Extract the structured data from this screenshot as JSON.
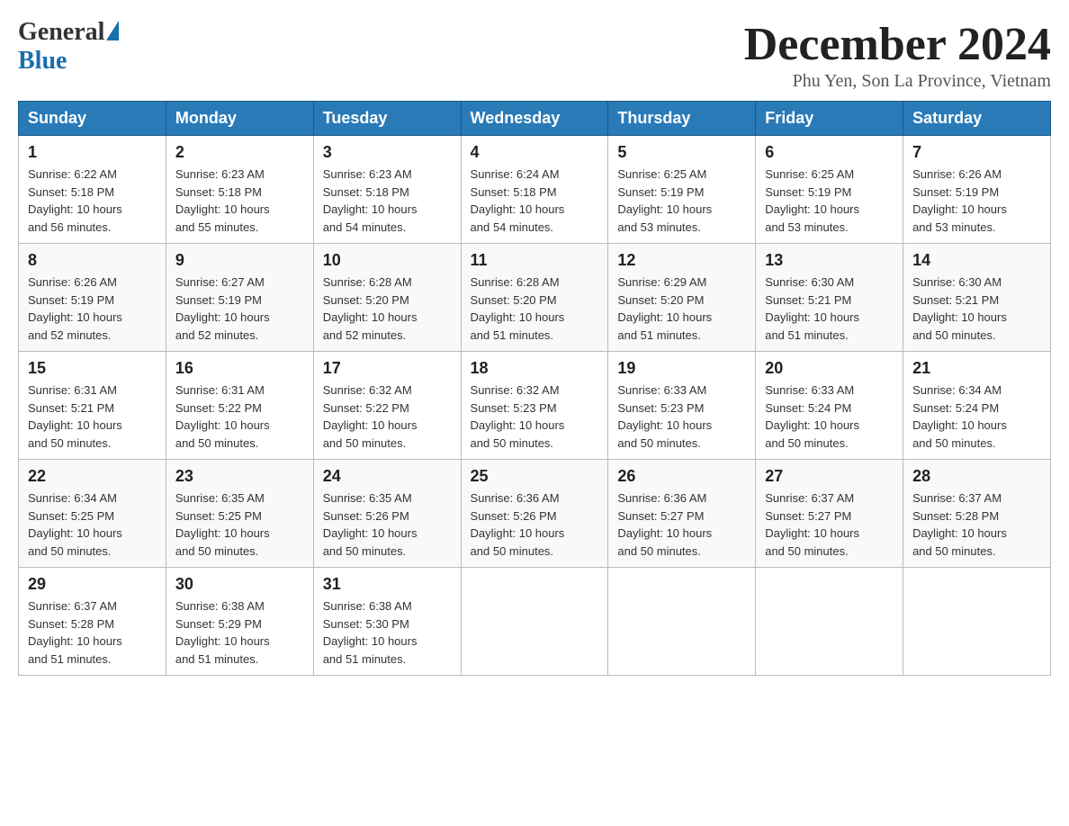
{
  "header": {
    "title": "December 2024",
    "location": "Phu Yen, Son La Province, Vietnam",
    "logo": {
      "general": "General",
      "blue": "Blue"
    }
  },
  "days_of_week": [
    "Sunday",
    "Monday",
    "Tuesday",
    "Wednesday",
    "Thursday",
    "Friday",
    "Saturday"
  ],
  "weeks": [
    [
      {
        "day": "1",
        "sunrise": "6:22 AM",
        "sunset": "5:18 PM",
        "daylight": "10 hours and 56 minutes."
      },
      {
        "day": "2",
        "sunrise": "6:23 AM",
        "sunset": "5:18 PM",
        "daylight": "10 hours and 55 minutes."
      },
      {
        "day": "3",
        "sunrise": "6:23 AM",
        "sunset": "5:18 PM",
        "daylight": "10 hours and 54 minutes."
      },
      {
        "day": "4",
        "sunrise": "6:24 AM",
        "sunset": "5:18 PM",
        "daylight": "10 hours and 54 minutes."
      },
      {
        "day": "5",
        "sunrise": "6:25 AM",
        "sunset": "5:19 PM",
        "daylight": "10 hours and 53 minutes."
      },
      {
        "day": "6",
        "sunrise": "6:25 AM",
        "sunset": "5:19 PM",
        "daylight": "10 hours and 53 minutes."
      },
      {
        "day": "7",
        "sunrise": "6:26 AM",
        "sunset": "5:19 PM",
        "daylight": "10 hours and 53 minutes."
      }
    ],
    [
      {
        "day": "8",
        "sunrise": "6:26 AM",
        "sunset": "5:19 PM",
        "daylight": "10 hours and 52 minutes."
      },
      {
        "day": "9",
        "sunrise": "6:27 AM",
        "sunset": "5:19 PM",
        "daylight": "10 hours and 52 minutes."
      },
      {
        "day": "10",
        "sunrise": "6:28 AM",
        "sunset": "5:20 PM",
        "daylight": "10 hours and 52 minutes."
      },
      {
        "day": "11",
        "sunrise": "6:28 AM",
        "sunset": "5:20 PM",
        "daylight": "10 hours and 51 minutes."
      },
      {
        "day": "12",
        "sunrise": "6:29 AM",
        "sunset": "5:20 PM",
        "daylight": "10 hours and 51 minutes."
      },
      {
        "day": "13",
        "sunrise": "6:30 AM",
        "sunset": "5:21 PM",
        "daylight": "10 hours and 51 minutes."
      },
      {
        "day": "14",
        "sunrise": "6:30 AM",
        "sunset": "5:21 PM",
        "daylight": "10 hours and 50 minutes."
      }
    ],
    [
      {
        "day": "15",
        "sunrise": "6:31 AM",
        "sunset": "5:21 PM",
        "daylight": "10 hours and 50 minutes."
      },
      {
        "day": "16",
        "sunrise": "6:31 AM",
        "sunset": "5:22 PM",
        "daylight": "10 hours and 50 minutes."
      },
      {
        "day": "17",
        "sunrise": "6:32 AM",
        "sunset": "5:22 PM",
        "daylight": "10 hours and 50 minutes."
      },
      {
        "day": "18",
        "sunrise": "6:32 AM",
        "sunset": "5:23 PM",
        "daylight": "10 hours and 50 minutes."
      },
      {
        "day": "19",
        "sunrise": "6:33 AM",
        "sunset": "5:23 PM",
        "daylight": "10 hours and 50 minutes."
      },
      {
        "day": "20",
        "sunrise": "6:33 AM",
        "sunset": "5:24 PM",
        "daylight": "10 hours and 50 minutes."
      },
      {
        "day": "21",
        "sunrise": "6:34 AM",
        "sunset": "5:24 PM",
        "daylight": "10 hours and 50 minutes."
      }
    ],
    [
      {
        "day": "22",
        "sunrise": "6:34 AM",
        "sunset": "5:25 PM",
        "daylight": "10 hours and 50 minutes."
      },
      {
        "day": "23",
        "sunrise": "6:35 AM",
        "sunset": "5:25 PM",
        "daylight": "10 hours and 50 minutes."
      },
      {
        "day": "24",
        "sunrise": "6:35 AM",
        "sunset": "5:26 PM",
        "daylight": "10 hours and 50 minutes."
      },
      {
        "day": "25",
        "sunrise": "6:36 AM",
        "sunset": "5:26 PM",
        "daylight": "10 hours and 50 minutes."
      },
      {
        "day": "26",
        "sunrise": "6:36 AM",
        "sunset": "5:27 PM",
        "daylight": "10 hours and 50 minutes."
      },
      {
        "day": "27",
        "sunrise": "6:37 AM",
        "sunset": "5:27 PM",
        "daylight": "10 hours and 50 minutes."
      },
      {
        "day": "28",
        "sunrise": "6:37 AM",
        "sunset": "5:28 PM",
        "daylight": "10 hours and 50 minutes."
      }
    ],
    [
      {
        "day": "29",
        "sunrise": "6:37 AM",
        "sunset": "5:28 PM",
        "daylight": "10 hours and 51 minutes."
      },
      {
        "day": "30",
        "sunrise": "6:38 AM",
        "sunset": "5:29 PM",
        "daylight": "10 hours and 51 minutes."
      },
      {
        "day": "31",
        "sunrise": "6:38 AM",
        "sunset": "5:30 PM",
        "daylight": "10 hours and 51 minutes."
      },
      null,
      null,
      null,
      null
    ]
  ],
  "labels": {
    "sunrise": "Sunrise:",
    "sunset": "Sunset:",
    "daylight": "Daylight:"
  }
}
